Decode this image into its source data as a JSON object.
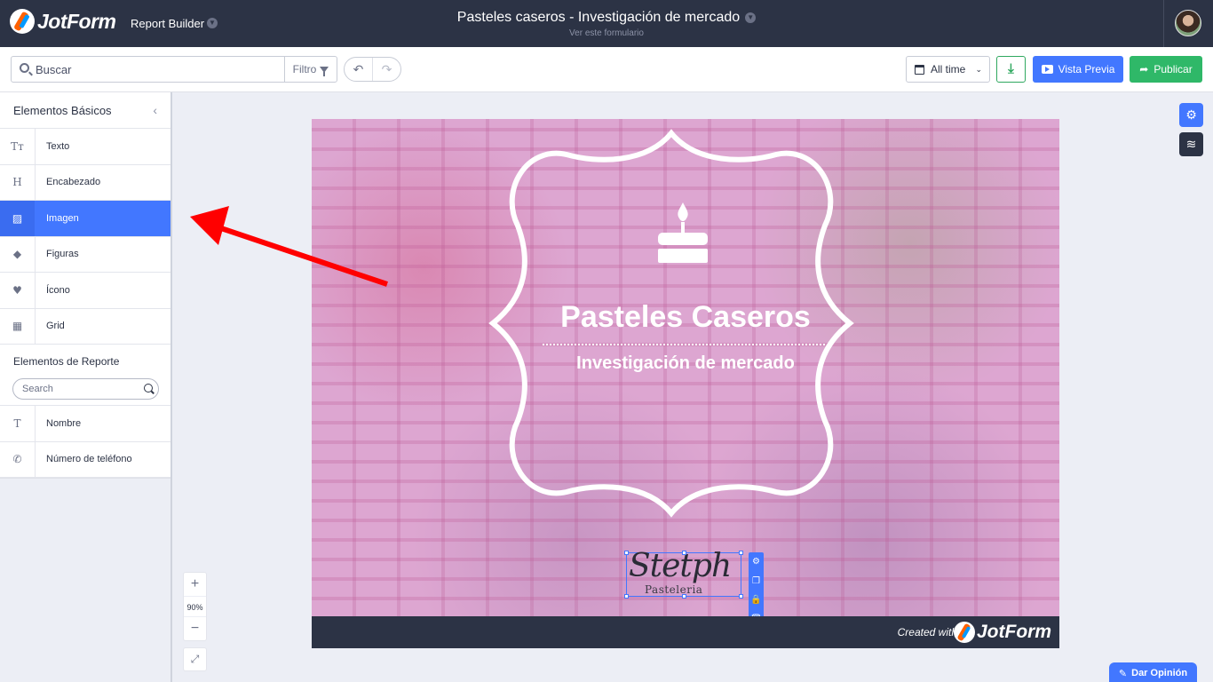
{
  "topbar": {
    "logo_text": "JotForm",
    "app_name": "Report Builder",
    "form_title": "Pasteles caseros - Investigación de mercado",
    "form_subtitle": "Ver este formulario"
  },
  "toolbar": {
    "search_placeholder": "Buscar",
    "filter_label": "Filtro",
    "undo_glyph": "↶",
    "redo_glyph": "↷",
    "date_range": "All time",
    "download_glyph": "⤓",
    "preview_label": "Vista Previa",
    "publish_label": "Publicar",
    "publish_glyph": "➦"
  },
  "sidebar": {
    "basic_title": "Elementos Básicos",
    "collapse_glyph": "‹",
    "basic_items": [
      {
        "label": "Texto",
        "icon": "text-icon",
        "glyph": "Tт"
      },
      {
        "label": "Encabezado",
        "icon": "heading-icon",
        "glyph": "H"
      },
      {
        "label": "Imagen",
        "icon": "image-icon",
        "glyph": "▨"
      },
      {
        "label": "Figuras",
        "icon": "shapes-icon",
        "glyph": "◆"
      },
      {
        "label": "Ícono",
        "icon": "icon-icon",
        "glyph": "♥"
      },
      {
        "label": "Grid",
        "icon": "grid-icon",
        "glyph": "▦"
      }
    ],
    "report_title": "Elementos de Reporte",
    "report_search_placeholder": "Search",
    "report_items": [
      {
        "label": "Nombre",
        "icon": "name-icon",
        "glyph": "T"
      },
      {
        "label": "Número de teléfono",
        "icon": "phone-icon",
        "glyph": "✆"
      }
    ]
  },
  "slide": {
    "title": "Pasteles Caseros",
    "subtitle": "Investigación de mercado",
    "footer_created": "Created with",
    "footer_logo": "JotForm",
    "logo_script": "Stetph",
    "logo_sub": "Pasteleria"
  },
  "zoom": {
    "plus": "+",
    "value": "90%",
    "minus": "−",
    "expand_glyph": "⤢"
  },
  "right_tools": {
    "gear_glyph": "⚙",
    "layers_glyph": "≋"
  },
  "selection_tools": {
    "gear": "⚙",
    "copy": "❐",
    "lock": "🔒",
    "trash": "🗑"
  },
  "feedback": {
    "label": "Dar Opinión",
    "glyph": "✎"
  },
  "colors": {
    "topbar": "#2c3345",
    "accent_blue": "#4277ff",
    "publish_green": "#2fb868",
    "slide_bg": "#dda6d1",
    "annotation_red": "#ff0000"
  }
}
